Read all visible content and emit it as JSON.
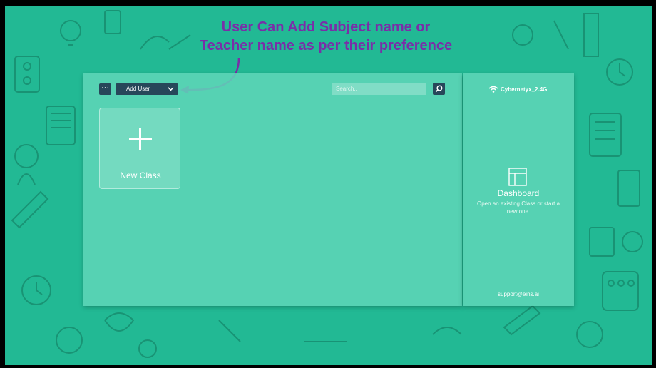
{
  "annotation": {
    "line1": "User Can Add Subject name or",
    "line2": "Teacher name as per their preference"
  },
  "toolbar": {
    "more_label": "···",
    "user_select": {
      "selected": "Add User",
      "chevron": "chevron-down-icon"
    },
    "search": {
      "placeholder": "Search..",
      "icon": "search-icon"
    }
  },
  "main": {
    "new_class": {
      "label": "New Class",
      "icon": "plus-icon"
    }
  },
  "sidebar": {
    "network": {
      "icon": "wifi-icon",
      "name": "Cybernetyx_2.4G"
    },
    "dashboard": {
      "icon": "dashboard-layout-icon",
      "title": "Dashboard",
      "description": "Open an existing Class or start a new one."
    },
    "support_email": "support@eins.ai"
  },
  "colors": {
    "background": "#22b994",
    "panel": "#60d6b8",
    "button": "#27475a",
    "annotation": "#7a2ea8"
  }
}
